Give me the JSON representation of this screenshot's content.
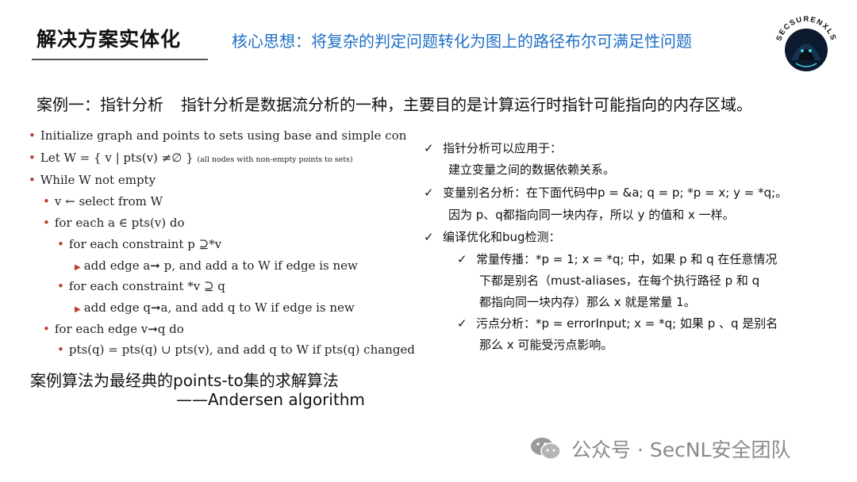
{
  "header": {
    "title": "解决方案实体化",
    "subtitle": "核心思想：将复杂的判定问题转化为图上的路径布尔可满足性问题"
  },
  "logo": {
    "text": "SECSURENXLS",
    "icon": "hacker-hood-icon"
  },
  "case": {
    "label": "案例一：指针分析",
    "description": "指针分析是数据流分析的一种，主要目的是计算运行时指针可能指向的内存区域。"
  },
  "algorithm": {
    "lines": [
      "Initialize graph and points to sets using base and simple const",
      "Let W = { v | pts(v) ≠∅ }",
      "(all nodes with non-empty points to sets)",
      "While W not empty",
      "v ← select from W",
      "for each a ∈ pts(v) do",
      "for each constraint p ⊇*v",
      "add edge a➞ p, and add a to W if edge is new",
      "for each constraint *v ⊇ q",
      "add edge q➞a, and add q to W if edge is new",
      "for each edge v➞q do",
      "pts(q) = pts(q) ∪ pts(v), and add q to W if pts(q) changed"
    ]
  },
  "caption": {
    "line1": "案例算法为最经典的points-to集的求解算法",
    "line2": "——Andersen algorithm"
  },
  "right_list": [
    "指针分析可以应用于：",
    "建立变量之间的数据依赖关系。",
    "变量别名分析：在下面代码中p = &a; q = p; *p = x; y = *q;。",
    "因为 p、q都指向同一块内存，所以  y 的值和 x 一样。",
    "编译优化和bug检测：",
    "常量传播：*p = 1; x = *q; 中，如果 p 和 q 在任意情况",
    "下都是别名（must-aliases，在每个执行路径  p 和 q",
    "都指向同一块内存）那么  x 就是常量  1。",
    "污点分析：*p = errorInput; x = *q; 如果 p 、q 是别名",
    "那么 x 可能受污点影响。"
  ],
  "check_mark": "✓",
  "watermark": {
    "text": "公众号 · SecNL安全团队",
    "icon": "wechat-icon"
  },
  "colors": {
    "subtitle": "#1f6fc5",
    "bullet": "#c0392b"
  }
}
